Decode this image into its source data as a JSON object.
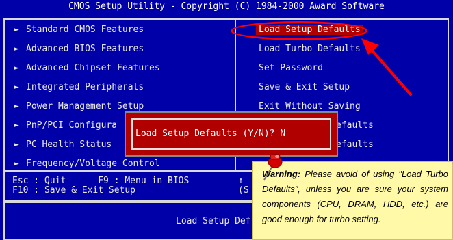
{
  "header": {
    "title": "CMOS Setup Utility - Copyright (C) 1984-2000 Award Software"
  },
  "menu_left": [
    "Standard CMOS Features",
    "Advanced BIOS Features",
    "Advanced Chipset Features",
    "Integrated Peripherals",
    "Power Management Setup",
    "PnP/PCI Configura",
    "PC Health Status",
    "Frequency/Voltage Control"
  ],
  "menu_right": [
    "Load Setup Defaults",
    "Load Turbo Defaults",
    "Set Password",
    "Save & Exit Setup",
    "Exit Without Saving",
    "efaults",
    "efaults"
  ],
  "menu_arrow_glyph": "►",
  "dialog": {
    "text": "Load Setup Defaults (Y/N)? N"
  },
  "help": {
    "line1": "Esc : Quit      F9 : Menu in BIOS",
    "line2": "F10 : Save & Exit Setup",
    "line1_right": "↑",
    "line2_right": "(S"
  },
  "status": {
    "text": "Load Setup Def"
  },
  "warning": {
    "label": "Warning:",
    "text": "Please avoid of using \"Load Turbo Defaults\", unless you are sure your system components (CPU, DRAM, HDD, etc.) are good enough for turbo setting."
  },
  "colors": {
    "bios_blue": "#0000a8",
    "selection_red": "#b00000",
    "annotation_red": "#ff0000",
    "note_yellow": "#fff9a8"
  }
}
